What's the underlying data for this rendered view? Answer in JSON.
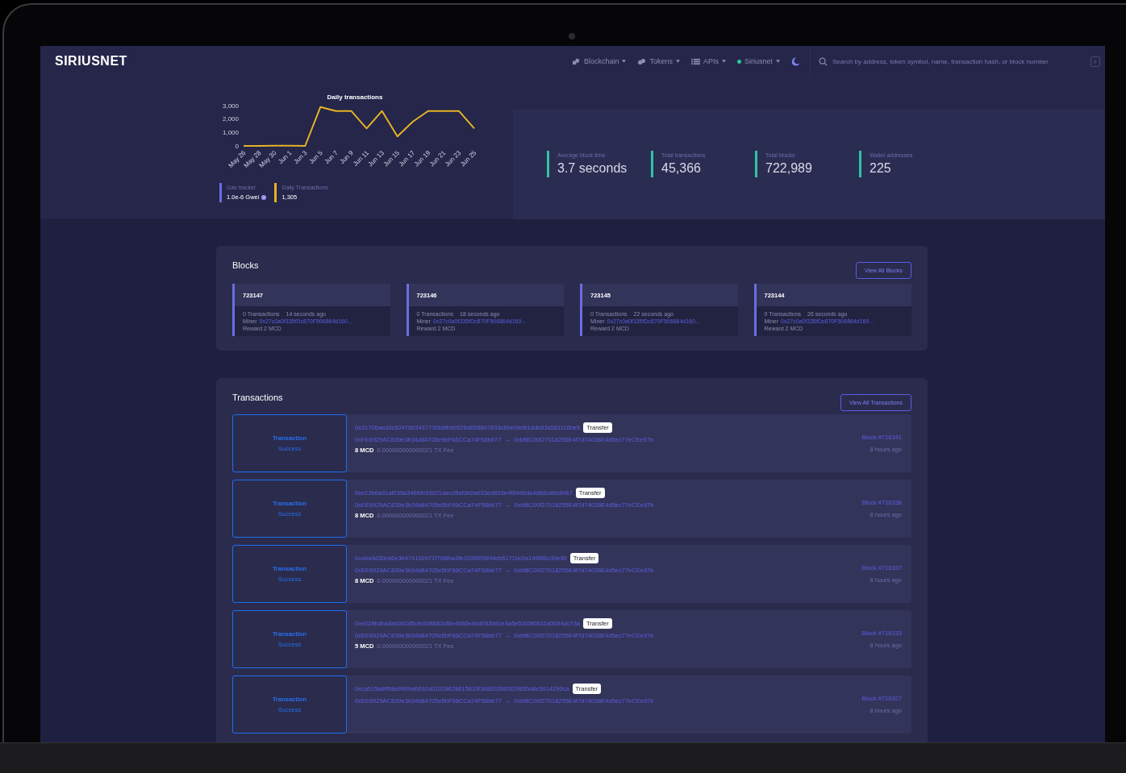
{
  "nav": {
    "logo": "SIRIUSNET",
    "items": [
      {
        "label": "Blockchain",
        "kind": "cubes"
      },
      {
        "label": "Tokens",
        "kind": "coins"
      },
      {
        "label": "APIs",
        "kind": "list"
      }
    ],
    "network": {
      "label": "Siriusnet",
      "color": "#2ec4a0"
    },
    "search": {
      "placeholder": "Search by address, token symbol, name, transaction hash, or block number",
      "shortcut": "/"
    }
  },
  "overview": {
    "chart": {
      "chart_data": {
        "type": "line",
        "title": "Daily transactions",
        "categories": [
          "May 26",
          "May 28",
          "May 30",
          "Jun 1",
          "Jun 3",
          "Jun 5",
          "Jun 7",
          "Jun 9",
          "Jun 11",
          "Jun 13",
          "Jun 15",
          "Jun 17",
          "Jun 19",
          "Jun 21",
          "Jun 23",
          "Jun 25"
        ],
        "series": [
          {
            "color": "#e6b325",
            "values": [
              0,
              0,
              20,
              10,
              0,
              2900,
              2600,
              2600,
              1300,
              2600,
              700,
              1800,
              2600,
              2600,
              2600,
              1300
            ]
          }
        ],
        "ylim": [
          0,
          3000
        ],
        "yticks": [
          {
            "value": 0,
            "label": "0"
          },
          {
            "value": 1000,
            "label": "1,000"
          },
          {
            "value": 2000,
            "label": "2,000"
          },
          {
            "value": 3000,
            "label": "3,000"
          }
        ]
      }
    },
    "gas_tracker": {
      "label": "Gas tracker",
      "value": "1.0e-6 Gwei"
    },
    "daily_transactions": {
      "label": "Daily Transactions",
      "value": "1,305"
    },
    "stats": [
      {
        "label": "Average block time",
        "value": "3.7 seconds"
      },
      {
        "label": "Total transactions",
        "value": "45,366"
      },
      {
        "label": "Total blocks",
        "value": "722,989"
      },
      {
        "label": "Wallet addresses",
        "value": "225"
      }
    ]
  },
  "blocks": {
    "title": "Blocks",
    "button": "View All Blocks",
    "items": [
      {
        "number": "723147",
        "transactions": "0 Transactions",
        "age": "14 seconds ago",
        "miner_label": "Miner",
        "miner": "0x27c0a0f335fDc870F506864d160...",
        "reward": "Reward 2 MCD"
      },
      {
        "number": "723146",
        "transactions": "0 Transactions",
        "age": "18 seconds ago",
        "miner_label": "Miner",
        "miner": "0x27c0a0f335fDc870F506864d160...",
        "reward": "Reward 2 MCD"
      },
      {
        "number": "723145",
        "transactions": "0 Transactions",
        "age": "22 seconds ago",
        "miner_label": "Miner",
        "miner": "0x27c0a0f335fDc870F506864d160...",
        "reward": "Reward 2 MCD"
      },
      {
        "number": "723144",
        "transactions": "0 Transactions",
        "age": "26 seconds ago",
        "miner_label": "Miner",
        "miner": "0x27c0a0f335fDc870F506864d160...",
        "reward": "Reward 2 MCD"
      }
    ]
  },
  "transactions": {
    "title": "Transactions",
    "button": "View All Transactions",
    "items": [
      {
        "type_label": "Transaction",
        "status": "Success",
        "hash": "0x31706aed3c8247603437730b0fb90526d658807893c8be0fef81ddb83a581116be5",
        "tag": "Transfer",
        "from": "0xFE6929AC839e3b34d84705e9bF66CCa74F58bb77",
        "arrow": "→",
        "to": "0xbf8C00f27018255E4f7d74038E4d5ec77eCEe97b",
        "amount": "8 MCD",
        "fee": "0.000000000000021 TX Fee",
        "block": "Block #716341",
        "age": "8 hours ago"
      },
      {
        "type_label": "Transaction",
        "status": "Success",
        "hash": "0xe23b6a91af035a346fdb93021aecd5af3b0ab33ed803e4f64d0da4d68ca6b8467",
        "tag": "Transfer",
        "from": "0xEE6929AC839e3b34d84705e5bF66CCa74F58bb77",
        "arrow": "→",
        "to": "0xbf8C00f27018255E4f7d74038E4d5ec77eCEe97b",
        "amount": "8 MCD",
        "fee": "0.000000000000021 TX Fee",
        "block": "Block #716338",
        "age": "8 hours ago"
      },
      {
        "type_label": "Transaction",
        "status": "Success",
        "hash": "0xd4a9d30c66e3b474100971f798fba3fe1096f05894cb6171bc9a149f86c39e90",
        "tag": "Transfer",
        "from": "0xEE6929AC839e3b34d84705e5bF66CCa74F58bb77",
        "arrow": "→",
        "to": "0xbf8C00f27018255E4f7d74038E4d5ec77eCEe97b",
        "amount": "8 MCD",
        "fee": "0.000000000000021 TX Fee",
        "block": "Block #716337",
        "age": "8 hours ago"
      },
      {
        "type_label": "Transaction",
        "status": "Success",
        "hash": "0xe028bdba8dc0d185cfe008882cf8e4986e4bd033ddce3a5e5205f0632a0054dc73a",
        "tag": "Transfer",
        "from": "0xEE6929AC839e3b34d84705e5bF66CCa74F58bb77",
        "arrow": "→",
        "to": "0xbf8C00f27018255E4f7d74038E4d5ec77eCEe97b",
        "amount": "5 MCD",
        "fee": "0.000000000000021 TX Fee",
        "block": "Block #716333",
        "age": "8 hours ago"
      },
      {
        "type_label": "Transaction",
        "status": "Success",
        "hash": "0xca515a8ff68a9909d6692d01028628615833f3d8533fd0529835d8e5014290ca",
        "tag": "Transfer",
        "from": "0xEE6929AC839e3b34d84705e5bF66CCa74F58bb77",
        "arrow": "→",
        "to": "0xbf8C00f27018255E4f7d74038E4d5ec77eCEe97b",
        "block": "Block #716327",
        "age": "8 hours ago"
      }
    ]
  }
}
